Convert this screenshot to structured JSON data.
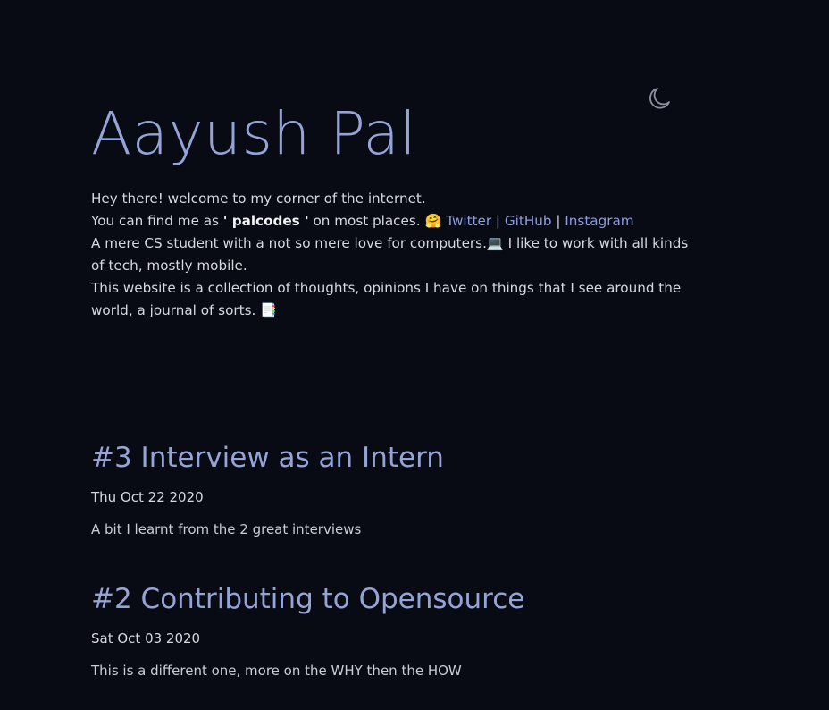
{
  "theme_toggle": {
    "icon": "moon-icon"
  },
  "header": {
    "title": "Aayush Pal"
  },
  "intro": {
    "line1": "Hey there! welcome to my corner of the internet.",
    "line2_prefix": "You can find me as ",
    "handle": "' palcodes '",
    "line2_suffix": " on most places. 🤗 ",
    "links": {
      "twitter": "Twitter",
      "github": "GitHub",
      "instagram": "Instagram"
    },
    "separator": " | ",
    "line3": "A mere CS student with a not so mere love for computers.💻  I like to work with all kinds of tech, mostly mobile.",
    "line4": "This website is a collection of thoughts, opinions I have on things that I see around the world, a journal of sorts. 📑"
  },
  "posts": [
    {
      "title": "#3 Interview as an Intern",
      "date": "Thu Oct 22 2020",
      "description": "A bit I learnt from the 2 great interviews"
    },
    {
      "title": "#2 Contributing to Opensource",
      "date": "Sat Oct 03 2020",
      "description": "This is a different one, more on the WHY then the HOW"
    }
  ]
}
